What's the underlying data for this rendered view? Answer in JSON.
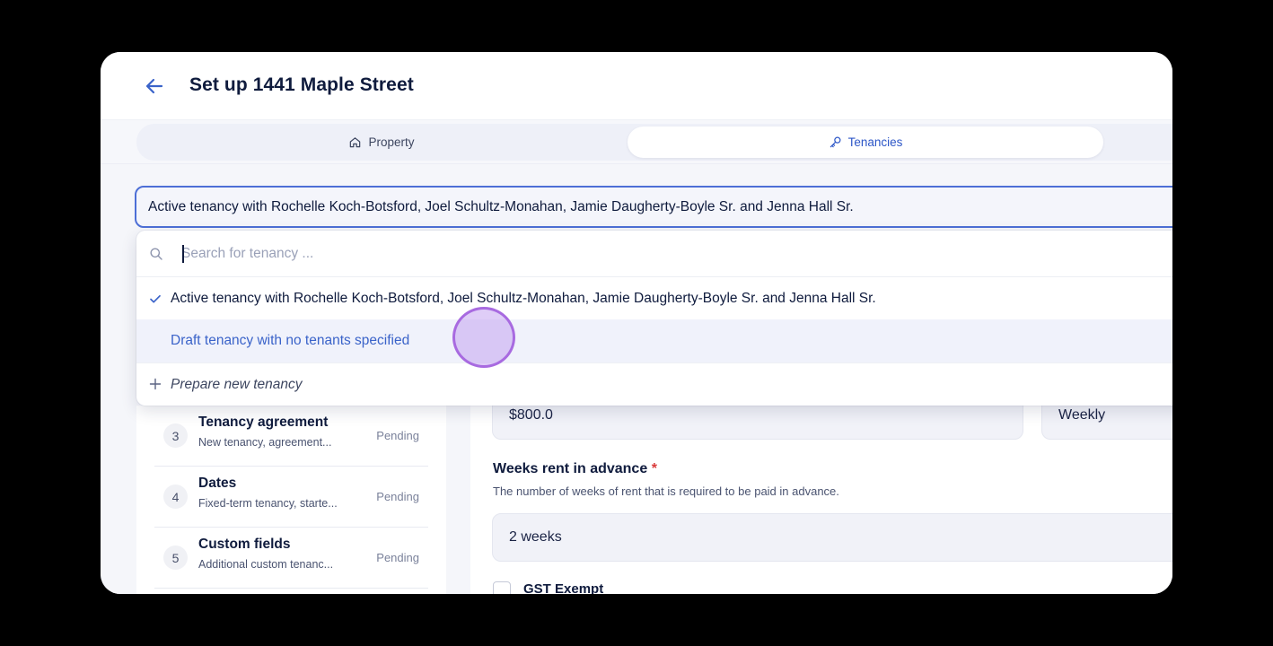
{
  "header": {
    "title": "Set up 1441 Maple Street",
    "back_icon": "arrow-left-icon"
  },
  "tabs": [
    {
      "label": "Property",
      "icon": "home-icon",
      "active": false
    },
    {
      "label": "Tenancies",
      "icon": "key-icon",
      "active": true
    }
  ],
  "tenancy_select": {
    "selected": "Active tenancy with Rochelle Koch-Botsford, Joel Schultz-Monahan, Jamie Daugherty-Boyle Sr. and Jenna Hall Sr.",
    "search_placeholder": "Search for tenancy ...",
    "options": [
      {
        "label": "Active tenancy with Rochelle Koch-Botsford, Joel Schultz-Monahan, Jamie Daugherty-Boyle Sr. and Jenna Hall Sr.",
        "selected": true
      },
      {
        "label": "Draft tenancy with no tenants specified",
        "selected": false,
        "hovered": true
      }
    ],
    "new_option": "Prepare new tenancy"
  },
  "steps": [
    {
      "number": "3",
      "title": "Tenancy agreement",
      "subtitle": "New tenancy, agreement...",
      "status": "Pending"
    },
    {
      "number": "4",
      "title": "Dates",
      "subtitle": "Fixed-term tenancy, starte...",
      "status": "Pending"
    },
    {
      "number": "5",
      "title": "Custom fields",
      "subtitle": "Additional custom tenanc...",
      "status": "Pending"
    }
  ],
  "form": {
    "rent_amount": "$800.0",
    "rent_frequency": "Weekly",
    "weeks_label": "Weeks rent in advance",
    "weeks_required_mark": "*",
    "weeks_help": "The number of weeks of rent that is required to be paid in advance.",
    "weeks_value": "2 weeks",
    "gst_label": "GST Exempt"
  },
  "colors": {
    "accent": "#3a63c9",
    "select_border": "#4d6fd6",
    "required": "#d93b3b",
    "cursor_ring": "#a86ae0"
  }
}
